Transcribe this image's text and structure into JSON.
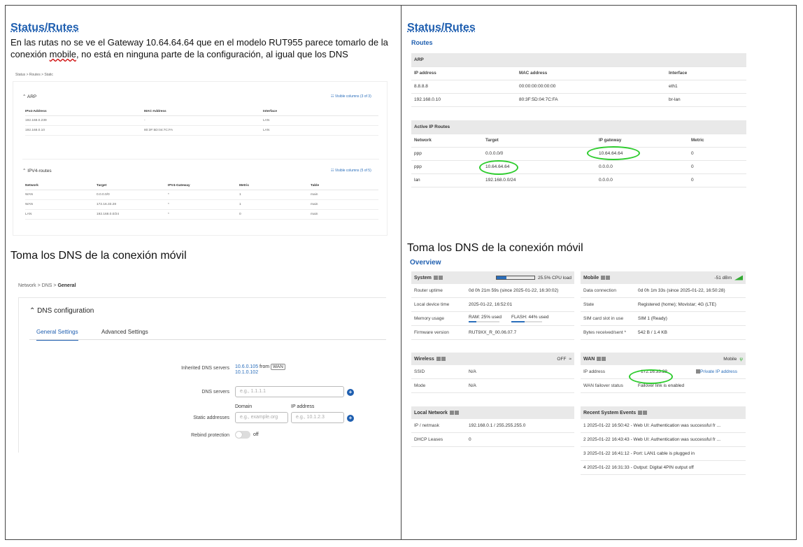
{
  "left": {
    "title": "Status/Rutes",
    "paragraph_before": "En las rutas no se ve el Gateway 10.64.64.64 que en el modelo RUT955 parece tomarlo de la conexión ",
    "paragraph_wavy": "mobile",
    "paragraph_after": ", no está en ninguna parte de la configuración, al igual que los DNS",
    "shot1": {
      "breadcrumb": "Status  >  Routes  >  Static",
      "arp": {
        "header": "ARP",
        "visible_columns": "☷ Visible columns (3 of 3)",
        "columns": [
          "IPv4-Address",
          "MAC-Address",
          "Interface"
        ],
        "rows": [
          [
            "192.168.0.239",
            "-",
            "LAN"
          ],
          [
            "192.168.0.10",
            "80:3F:5D:04:7C:FA",
            "LAN"
          ]
        ]
      },
      "ipv4": {
        "header": "IPV4-routes",
        "visible_columns": "☷ Visible columns (5 of 5)",
        "columns": [
          "Network",
          "Target",
          "IPV4-Gateway",
          "Metric",
          "Table"
        ],
        "rows": [
          [
            "WAN",
            "0.0.0.0/0",
            "*",
            "1",
            "main"
          ],
          [
            "WAN",
            "172.16.33.28",
            "*",
            "1",
            "main"
          ],
          [
            "LAN",
            "192.168.0.0/24",
            "*",
            "0",
            "main"
          ]
        ]
      }
    },
    "dns_caption": "Toma los DNS de la conexión móvil",
    "shot2": {
      "breadcrumb": [
        "Network",
        "DNS",
        "General"
      ],
      "header": "DNS configuration",
      "tabs": [
        "General Settings",
        "Advanced Settings"
      ],
      "inherited_label": "Inherited DNS servers",
      "inherited_1": "10.6.0.105",
      "inherited_from": "from",
      "inherited_wan": "WAN",
      "inherited_2": "10.1.0.102",
      "dns_servers_label": "DNS servers",
      "dns_placeholder": "e.g., 1.1.1.1",
      "domain_label": "Domain",
      "ip_label": "IP address",
      "static_label": "Static addresses",
      "domain_placeholder": "e.g., example.org",
      "ip_placeholder": "e.g., 10.1.2.3",
      "rebind_label": "Rebind protection",
      "rebind_state": "off"
    }
  },
  "right": {
    "title": "Status/Rutes",
    "routes_title": "Routes",
    "arp": {
      "header": "ARP",
      "columns": [
        "IP address",
        "MAC address",
        "Interface"
      ],
      "rows": [
        [
          "8.8.8.8",
          "00:00:00:00:00:00",
          "eth1"
        ],
        [
          "192.168.0.10",
          "80:3F:5D:04:7C:FA",
          "br-lan"
        ]
      ]
    },
    "active": {
      "header": "Active IP Routes",
      "columns": [
        "Network",
        "Target",
        "IP gateway",
        "Metric"
      ],
      "rows": [
        [
          "ppp",
          "0.0.0.0/0",
          "10.64.64.64",
          "0"
        ],
        [
          "ppp",
          "10.64.64.64",
          "0.0.0.0",
          "0"
        ],
        [
          "lan",
          "192.168.0.0/24",
          "0.0.0.0",
          "0"
        ]
      ]
    },
    "dns_caption": "Toma los DNS de la conexión móvil",
    "overview_title": "Overview",
    "system": {
      "title": "System",
      "cpu": "25.5% CPU load",
      "cpu_fraction": 0.255,
      "uptime_k": "Router uptime",
      "uptime_v": "0d 0h 21m 59s (since 2025-01-22, 16:30:02)",
      "time_k": "Local device time",
      "time_v": "2025-01-22, 16:52:01",
      "mem_k": "Memory usage",
      "ram": "RAM: 25% used",
      "flash": "FLASH: 44% used",
      "ram_fraction": 0.25,
      "flash_fraction": 0.44,
      "fw_k": "Firmware version",
      "fw_v": "RUT9XX_R_00.06.07.7"
    },
    "mobile": {
      "title": "Mobile",
      "signal": "-51 dBm",
      "conn_k": "Data connection",
      "conn_v": "0d 0h 1m 33s (since 2025-01-22, 16:50:28)",
      "state_k": "State",
      "state_v": "Registered (home); Movistar; 4G (LTE)",
      "sim_k": "SIM card slot in use",
      "sim_v": "SIM 1 (Ready)",
      "bytes_k": "Bytes received/sent *",
      "bytes_v": "542 B / 1.4 KB"
    },
    "wireless": {
      "title": "Wireless",
      "state": "OFF",
      "ssid_k": "SSID",
      "ssid_v": "N/A",
      "mode_k": "Mode",
      "mode_v": "N/A"
    },
    "wan": {
      "title": "WAN",
      "type": "Mobile",
      "ip_k": "IP address",
      "ip_v": "172.16.33.28",
      "private": "Private IP address",
      "fo_k": "WAN failover status",
      "fo_v": "Failover link is enabled"
    },
    "local": {
      "title": "Local Network",
      "ip_k": "IP / netmask",
      "ip_v": "192.168.0.1 / 255.255.255.0",
      "dhcp_k": "DHCP Leases",
      "dhcp_v": "0"
    },
    "events": {
      "title": "Recent System Events",
      "items": [
        "1   2025-01-22 16:50:42 - Web UI: Authentication was successful fr ...",
        "2   2025-01-22 16:43:43 - Web UI: Authentication was successful fr ...",
        "3   2025-01-22 16:41:12 - Port: LAN1 cable is plugged in",
        "4   2025-01-22 16:31:33 - Output: Digital 4PIN output off"
      ]
    }
  },
  "colors": {
    "accent": "#1f5fb0",
    "highlight": "#2ecc2e"
  }
}
